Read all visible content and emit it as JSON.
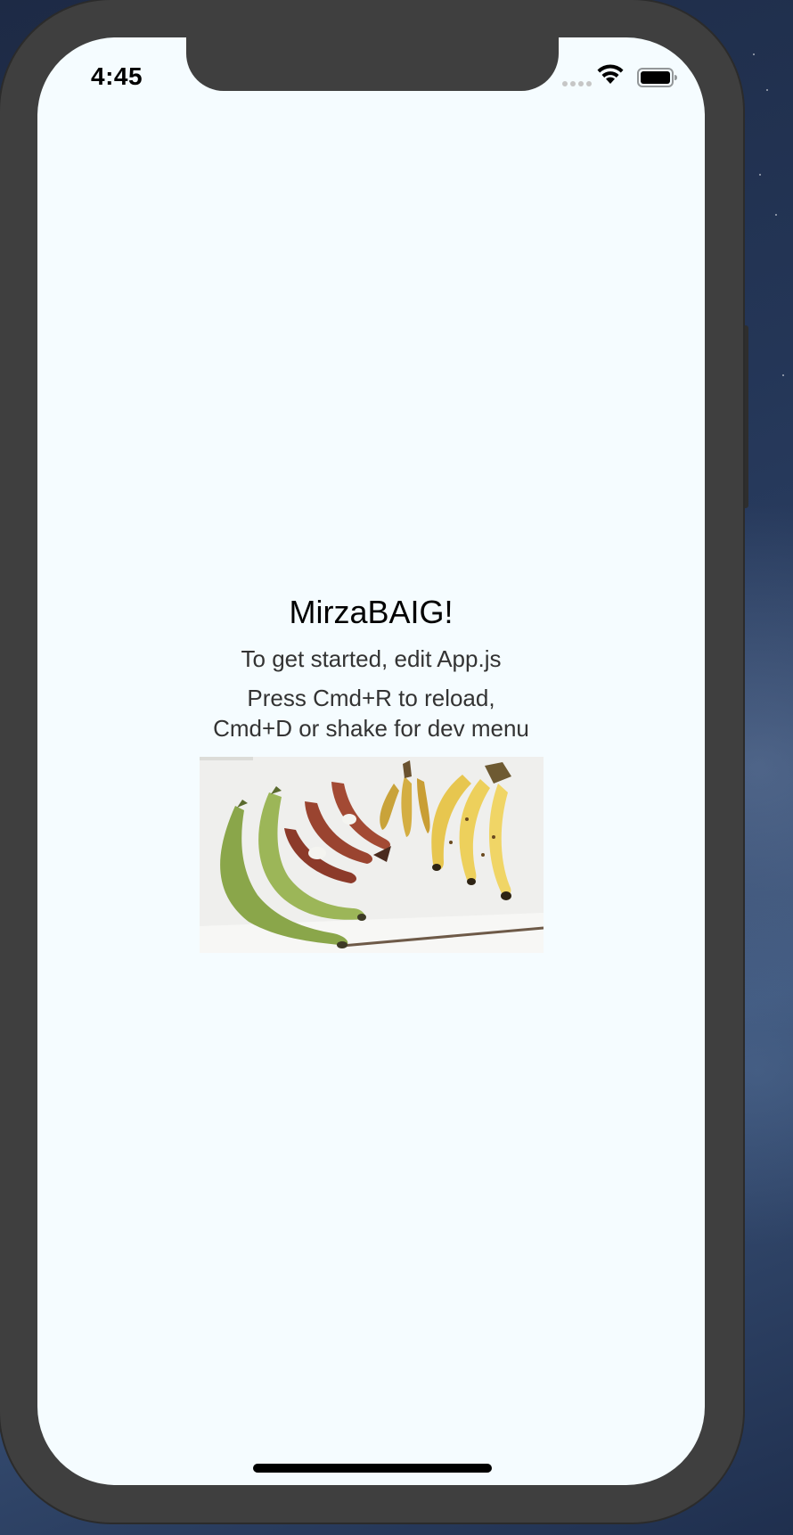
{
  "status_bar": {
    "time": "4:45"
  },
  "app": {
    "welcome": "MirzaBAIG!",
    "instructions": "To get started, edit App.js",
    "reload_line_1": "Press Cmd+R to reload,",
    "reload_line_2": "Cmd+D or shake for dev menu"
  },
  "image": {
    "description_icon": "bananas-photo"
  },
  "colors": {
    "screen_background": "#f5fcff",
    "phone_frame": "#3f3f3f"
  }
}
